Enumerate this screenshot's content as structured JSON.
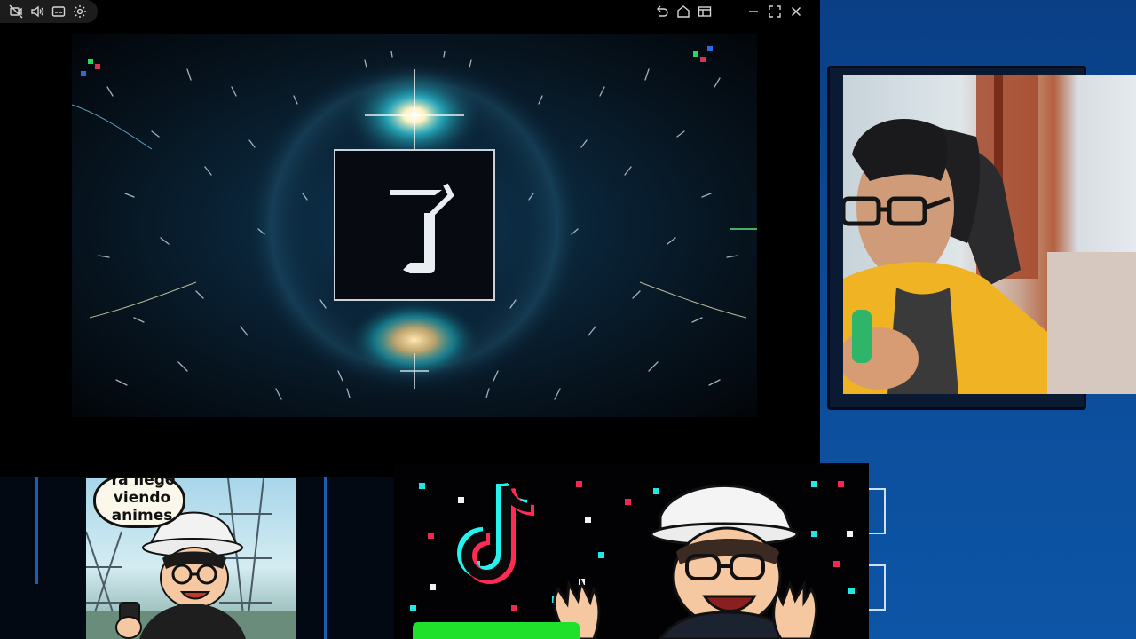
{
  "toolbar": {
    "left_icons": [
      "camera-off-icon",
      "volume-icon",
      "captions-icon",
      "settings-gear-icon"
    ],
    "right_icons": [
      "undo-icon",
      "home-icon",
      "window-layout-icon",
      "minimize-icon",
      "fullscreen-icon",
      "close-icon"
    ]
  },
  "video": {
    "logo_glyph": "了"
  },
  "comic": {
    "bubble_lines": [
      "Ya llegó",
      "viendo",
      "animes"
    ]
  },
  "colors": {
    "desktop_blue": "#0b4a96",
    "tiktok_cyan": "#25f4ee",
    "tiktok_red": "#fe2c55",
    "green_bar": "#1fe02a"
  }
}
